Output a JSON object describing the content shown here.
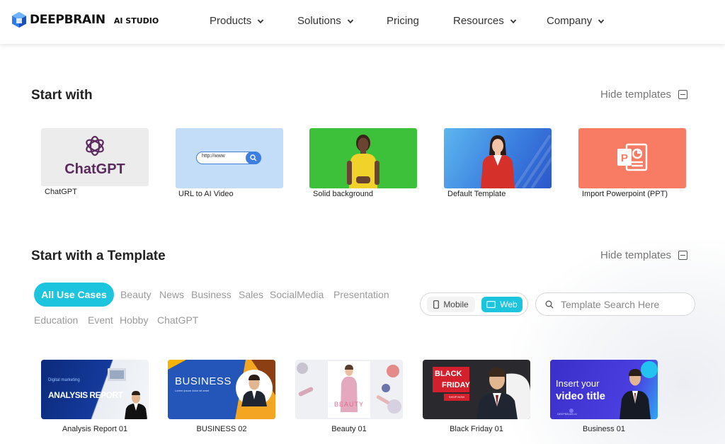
{
  "header": {
    "brand": "DEEPBRAIN",
    "brand_sub": "AI STUDIO",
    "nav": [
      {
        "label": "Products",
        "has_dropdown": true
      },
      {
        "label": "Solutions",
        "has_dropdown": true
      },
      {
        "label": "Pricing",
        "has_dropdown": false
      },
      {
        "label": "Resources",
        "has_dropdown": true
      },
      {
        "label": "Company",
        "has_dropdown": true
      }
    ]
  },
  "start_with": {
    "title": "Start with",
    "hide_label": "Hide templates",
    "cards": [
      {
        "label": "ChatGPT",
        "thumb_text": "ChatGPT"
      },
      {
        "label": "URL to AI Video",
        "thumb_text": "http://www"
      },
      {
        "label": "Solid background"
      },
      {
        "label": "Default Template"
      },
      {
        "label": "Import Powerpoint (PPT)"
      }
    ]
  },
  "template_section": {
    "title": "Start with a Template",
    "hide_label": "Hide templates",
    "categories_active": "All Use Cases",
    "categories": [
      "Beauty",
      "News",
      "Business",
      "Sales",
      "SocialMedia",
      "Presentation",
      "Education",
      "Event",
      "Hobby",
      "ChatGPT"
    ],
    "toggle": {
      "mobile": "Mobile",
      "web": "Web",
      "selected": "Web"
    },
    "search_placeholder": "Template Search Here",
    "templates": [
      {
        "label": "Analysis Report 01",
        "thumb_title": "ANALYSIS REPORT",
        "thumb_sub": "Digital marketing"
      },
      {
        "label": "BUSINESS 02",
        "thumb_title": "BUSINESS",
        "thumb_sub": "Lorem ipsum dolor sit amet"
      },
      {
        "label": "Beauty 01",
        "thumb_title": "BEAUTY"
      },
      {
        "label": "Black Friday 01",
        "thumb_title_1": "BLACK",
        "thumb_title_2": "FRIDAY",
        "thumb_cta": "SHOP NOW"
      },
      {
        "label": "Business 01",
        "thumb_title_1": "Insert your",
        "thumb_title_2": "video title",
        "thumb_sub": "DEEPBRAIN AI"
      }
    ]
  },
  "colors": {
    "accent": "#1cc4de",
    "chatgpt_purple": "#5b2a5e",
    "url_bg": "#c3dcf7",
    "solid_green": "#3dc13a",
    "ppt_coral": "#f87b63"
  }
}
